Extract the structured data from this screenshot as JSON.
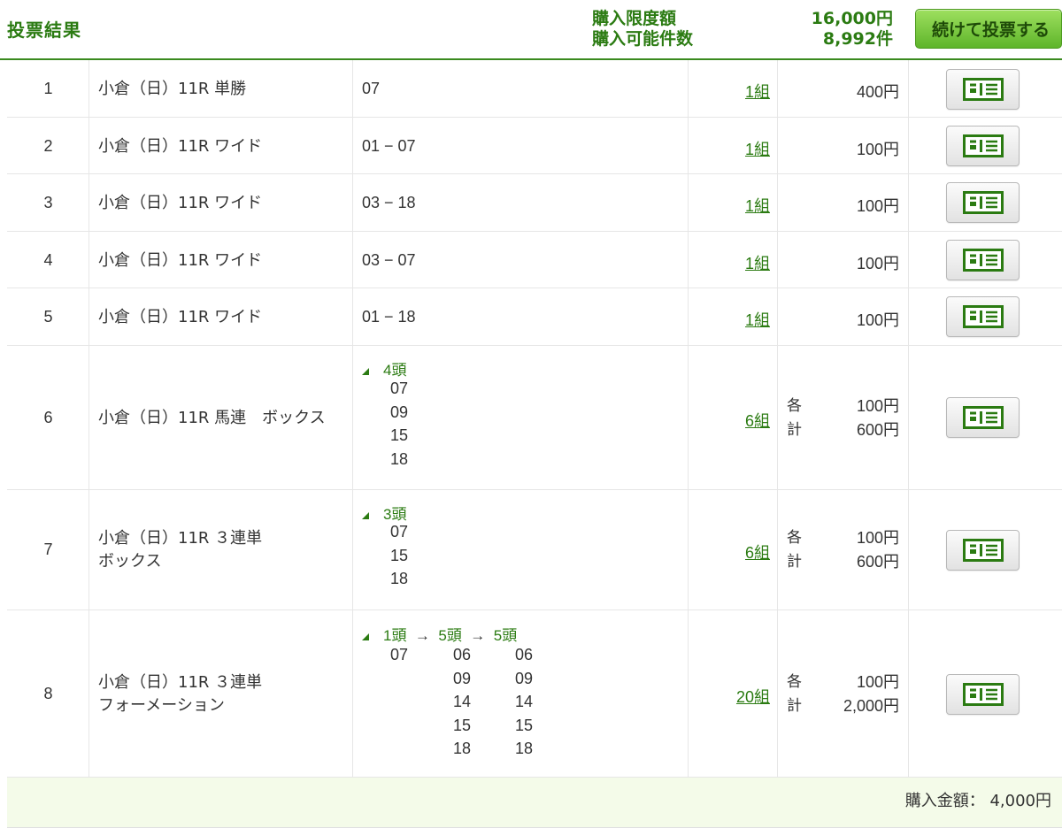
{
  "header": {
    "title": "投票結果",
    "limit_label": "購入限度額",
    "count_label": "購入可能件数",
    "limit_value": "16,000円",
    "count_value": "8,992件",
    "continue_label": "続けて投票する"
  },
  "rows": [
    {
      "no": "1",
      "race": "小倉（日）11R 単勝",
      "horses": "07",
      "sets": "1組",
      "amount": "400円"
    },
    {
      "no": "2",
      "race": "小倉（日）11R ワイド",
      "horses": "01 − 07",
      "sets": "1組",
      "amount": "100円"
    },
    {
      "no": "3",
      "race": "小倉（日）11R ワイド",
      "horses": "03 − 18",
      "sets": "1組",
      "amount": "100円"
    },
    {
      "no": "4",
      "race": "小倉（日）11R ワイド",
      "horses": "03 − 07",
      "sets": "1組",
      "amount": "100円"
    },
    {
      "no": "5",
      "race": "小倉（日）11R ワイド",
      "horses": "01 − 18",
      "sets": "1組",
      "amount": "100円"
    },
    {
      "no": "6",
      "race": "小倉（日）11R 馬連　ボックス",
      "head_count": "4頭",
      "horses_list": [
        "07",
        "09",
        "15",
        "18"
      ],
      "sets": "6組",
      "each_label": "各",
      "total_label": "計",
      "each": "100円",
      "total": "600円"
    },
    {
      "no": "7",
      "race_line1": "小倉（日）11R ３連単",
      "race_line2": "ボックス",
      "head_count": "3頭",
      "horses_list": [
        "07",
        "15",
        "18"
      ],
      "sets": "6組",
      "each_label": "各",
      "total_label": "計",
      "each": "100円",
      "total": "600円"
    },
    {
      "no": "8",
      "race_line1": "小倉（日）11R ３連単",
      "race_line2": "フォーメーション",
      "head_count": "1頭",
      "arrow": "→",
      "head_count2": "5頭",
      "head_count3": "5頭",
      "col1": [
        "07"
      ],
      "col2": [
        "06",
        "09",
        "14",
        "15",
        "18"
      ],
      "col3": [
        "06",
        "09",
        "14",
        "15",
        "18"
      ],
      "sets": "20組",
      "each_label": "各",
      "total_label": "計",
      "each": "100円",
      "total": "2,000円"
    }
  ],
  "footer": {
    "total_label": "購入金額：",
    "total_value": "4,000円"
  },
  "icons": {
    "detail": "ticket-icon"
  },
  "colors": {
    "accent": "#2b7b12",
    "button_green": "#5eb52a",
    "footer_bg": "#f4fbe9"
  }
}
